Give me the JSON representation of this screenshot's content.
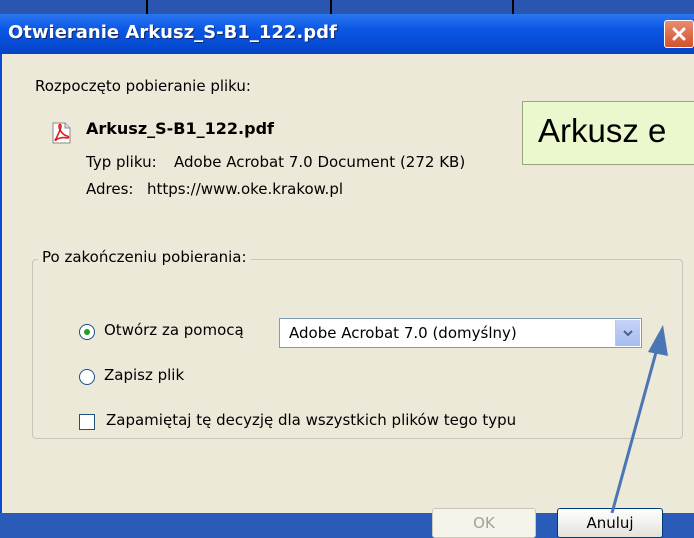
{
  "window": {
    "title": "Otwieranie Arkusz_S-B1_122.pdf",
    "colors": {
      "titlebar": "#0a56e3",
      "client": "#ece9d8",
      "close": "#d2522d"
    }
  },
  "dialog": {
    "intro": "Rozpoczęto pobieranie pliku:",
    "file_icon": "pdf-file-icon",
    "file_name": "Arkusz_S-B1_122.pdf",
    "type_label": "Typ pliku:",
    "type_value": "Adobe Acrobat 7.0 Document (272 KB)",
    "address_label": "Adres:",
    "address_value": "https://www.oke.krakow.pl",
    "group_title": "Po zakończeniu pobierania:",
    "open_with_label": "Otwórz za pomocą",
    "open_with_value": "Adobe Acrobat 7.0 (domyślny)",
    "open_with_selected": true,
    "save_label": "Zapisz plik",
    "save_selected": false,
    "remember_label": "Zapamiętaj tę decyzję dla wszystkich plików tego typu",
    "remember_checked": false,
    "ok_label": "OK",
    "cancel_label": "Anuluj"
  },
  "callout": {
    "text": "Arkusz e"
  }
}
